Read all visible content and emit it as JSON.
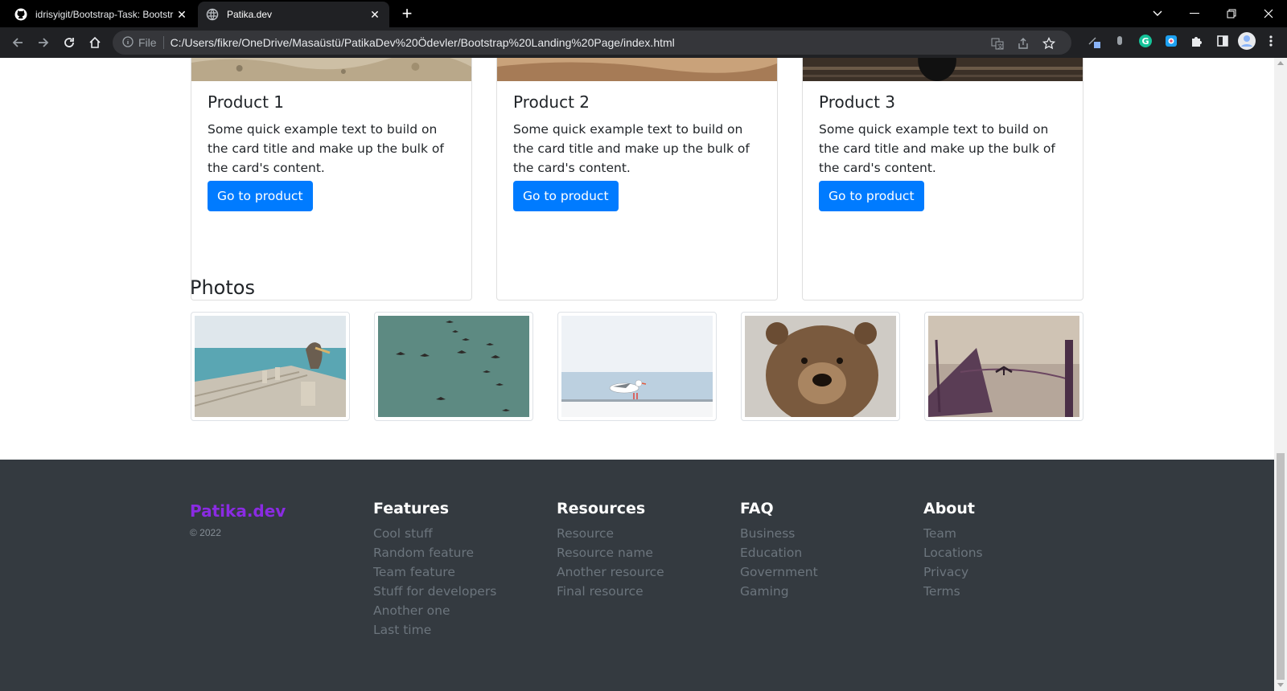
{
  "browser": {
    "tabs": [
      {
        "title": "idrisyigit/Bootstrap-Task: Bootstr",
        "icon": "github-icon",
        "active": false
      },
      {
        "title": "Patika.dev",
        "icon": "globe-icon",
        "active": true
      }
    ],
    "address": {
      "file_label": "File",
      "url": "C:/Users/fikre/OneDrive/Masaüstü/PatikaDev%20Ödevler/Bootstrap%20Landing%20Page/index.html"
    }
  },
  "products": [
    {
      "title": "Product 1",
      "text": "Some quick example text to build on the card title and make up the bulk of the card's content.",
      "button": "Go to product"
    },
    {
      "title": "Product 2",
      "text": "Some quick example text to build on the card title and make up the bulk of the card's content.",
      "button": "Go to product"
    },
    {
      "title": "Product 3",
      "text": "Some quick example text to build on the card title and make up the bulk of the card's content.",
      "button": "Go to product"
    }
  ],
  "photos": {
    "title": "Photos",
    "items": [
      "pelican-on-pier",
      "birds-flying",
      "seagull-on-railing",
      "brown-bear",
      "boat-at-sea"
    ]
  },
  "footer": {
    "brand": "Patika.dev",
    "copyright": "© 2022",
    "columns": [
      {
        "heading": "Features",
        "links": [
          "Cool stuff",
          "Random feature",
          "Team feature",
          "Stuff for developers",
          "Another one",
          "Last time"
        ]
      },
      {
        "heading": "Resources",
        "links": [
          "Resource",
          "Resource name",
          "Another resource",
          "Final resource"
        ]
      },
      {
        "heading": "FAQ",
        "links": [
          "Business",
          "Education",
          "Government",
          "Gaming"
        ]
      },
      {
        "heading": "About",
        "links": [
          "Team",
          "Locations",
          "Privacy",
          "Terms"
        ]
      }
    ]
  },
  "colors": {
    "primary_button": "#007bff",
    "brand": "#8a2be2",
    "footer_bg": "#343a40",
    "footer_link": "#6c757d"
  }
}
